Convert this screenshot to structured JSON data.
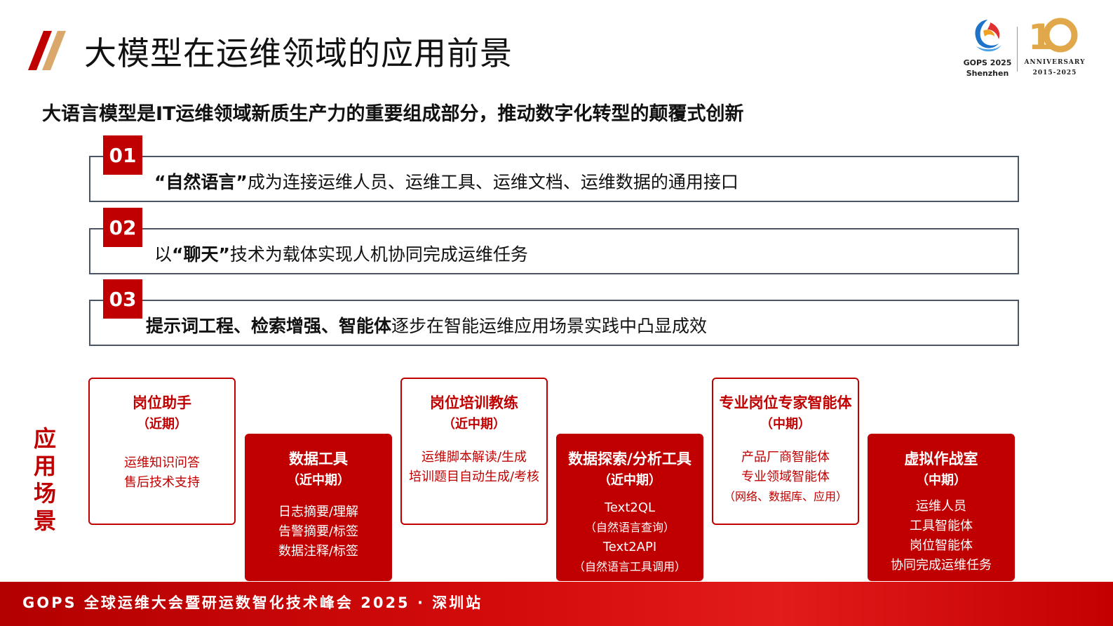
{
  "header": {
    "title": "大模型在运维领域的应用前景"
  },
  "logo": {
    "gops_line1": "GOPS 2025",
    "gops_line2": "Shenzhen",
    "anniversary": "ANNIVERSARY",
    "years": "2015-2025"
  },
  "subtitle": "大语言模型是IT运维领域新质生产力的重要组成部分，推动数字化转型的颠覆式创新",
  "items": [
    {
      "number": "01",
      "bold": "“自然语言”",
      "text": "成为连接运维人员、运维工具、运维文档、运维数据的通用接口"
    },
    {
      "number": "02",
      "prefix": "以",
      "bold": "“聊天”",
      "text": "技术为载体实现人机协同完成运维任务"
    },
    {
      "number": "03",
      "bold": "提示词工程、检索增强、智能体",
      "text": "逐步在智能运维应用场景实践中凸显成效"
    }
  ],
  "side_label": [
    "应",
    "用",
    "场",
    "景"
  ],
  "cards": [
    {
      "title": "岗位助手",
      "period": "（近期）",
      "lines": [
        "运维知识问答",
        "售后技术支持"
      ]
    },
    {
      "title": "数据工具",
      "period": "（近中期）",
      "lines": [
        "日志摘要/理解",
        "告警摘要/标签",
        "数据注释/标签"
      ]
    },
    {
      "title": "岗位培训教练",
      "period": "（近中期）",
      "lines": [
        "运维脚本解读/生成",
        "培训题目自动生成/考核"
      ]
    },
    {
      "title": "数据探索/分析工具",
      "period": "（近中期）",
      "lines": [
        "Text2QL",
        "（自然语言查询）",
        "Text2API",
        "（自然语言工具调用）"
      ]
    },
    {
      "title": "专业岗位专家智能体",
      "period": "（中期）",
      "lines": [
        "产品厂商智能体",
        "专业领域智能体",
        "（网络、数据库、应用）"
      ]
    },
    {
      "title": "虚拟作战室",
      "period": "（中期）",
      "lines": [
        "运维人员",
        "工具智能体",
        "岗位智能体",
        "协同完成运维任务"
      ]
    }
  ],
  "footer": "GOPS 全球运维大会暨研运数智化技术峰会 2025 · 深圳站",
  "colors": {
    "accent": "#c00000",
    "border": "#4b5563"
  }
}
